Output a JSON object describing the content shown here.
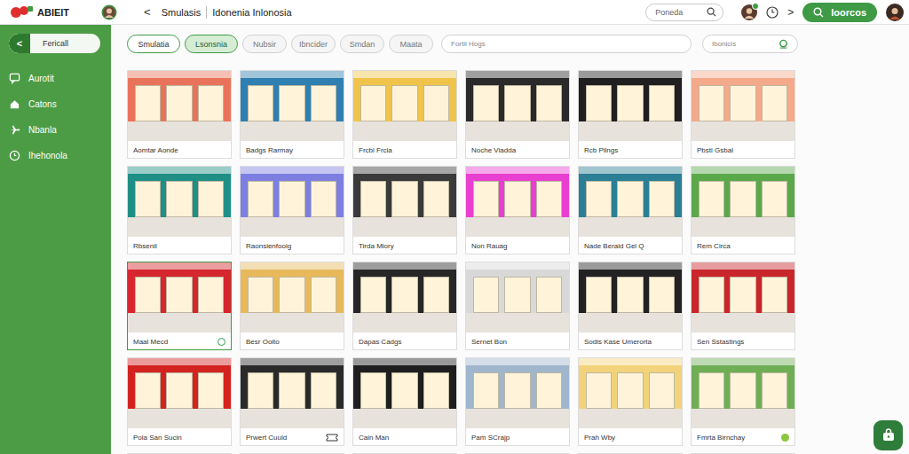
{
  "header": {
    "logo": "ABIEIT",
    "back": "<",
    "breadcrumb": [
      "Smulasis",
      "Idonenia Inlonosia"
    ],
    "search": {
      "placeholder": "Poneda"
    },
    "forward": ">",
    "primary_button": "Ioorcos"
  },
  "sidebar": {
    "back_button": {
      "icon": "<",
      "label": "Fericall"
    },
    "items": [
      {
        "label": "Aurotit",
        "selected": false
      },
      {
        "label": "Catons",
        "selected": false
      },
      {
        "label": "Nbanla",
        "selected": false
      },
      {
        "label": "Ihehonola",
        "selected": false
      }
    ]
  },
  "filters": {
    "chips": [
      {
        "label": "Smulatia",
        "selected": false,
        "outlined": true
      },
      {
        "label": "Lsonsnia",
        "selected": true,
        "outlined": true
      },
      {
        "label": "Nubsir",
        "selected": false,
        "outlined": false
      },
      {
        "label": "Ibncider",
        "selected": false,
        "outlined": false
      },
      {
        "label": "Smdan",
        "selected": false,
        "outlined": false
      },
      {
        "label": "Maata",
        "selected": false,
        "outlined": false
      }
    ],
    "search": {
      "placeholder": "Fortil Hogs"
    },
    "secondary_search": {
      "placeholder": "Ibonicis"
    }
  },
  "cards": [
    {
      "label": "Aomtar Aonde",
      "color": "#e9735a",
      "selected": false
    },
    {
      "label": "Badgs Rarmay",
      "color": "#2f7fb0",
      "selected": false
    },
    {
      "label": "Frcbi Frcia",
      "color": "#f0c44a",
      "selected": false
    },
    {
      "label": "Noche Viadda",
      "color": "#2a2a2a",
      "selected": false
    },
    {
      "label": "Rcb Pilngs",
      "color": "#1f1f1f",
      "selected": false
    },
    {
      "label": "Pbsti Gsbal",
      "color": "#f3a98a",
      "selected": false
    },
    {
      "label": "Rbsenil",
      "color": "#1f8f86",
      "selected": false
    },
    {
      "label": "Raonsienfooig",
      "color": "#7d7fe0",
      "selected": false
    },
    {
      "label": "Tirda Miory",
      "color": "#3a3a3a",
      "selected": false
    },
    {
      "label": "Non Rauag",
      "color": "#e93fd0",
      "selected": false
    },
    {
      "label": "Nade Berald Gel Q",
      "color": "#2a7f95",
      "selected": false
    },
    {
      "label": "Rem Circa",
      "color": "#5aa84a",
      "selected": false
    },
    {
      "label": "Maal Mecd",
      "color": "#d6262e",
      "selected": true,
      "badge": {
        "kind": "ring",
        "color": "#2e9e4f"
      }
    },
    {
      "label": "Besr Ooito",
      "color": "#e7b95a",
      "selected": false
    },
    {
      "label": "Dapas Cadgs",
      "color": "#262626",
      "selected": false
    },
    {
      "label": "Sernet Bon",
      "color": "#d8d8d8",
      "selected": false
    },
    {
      "label": "Sodis Kase Umerorta",
      "color": "#222222",
      "selected": false
    },
    {
      "label": "Sen Sstastings",
      "color": "#c9262c",
      "selected": false
    },
    {
      "label": "Pola San Sucin",
      "color": "#d3231f",
      "selected": false
    },
    {
      "label": "Prwert Cuuld",
      "color": "#2a2a2a",
      "selected": false,
      "badge": {
        "kind": "ticket",
        "color": "#333333"
      }
    },
    {
      "label": "Cain Man",
      "color": "#1e1e1e",
      "selected": false
    },
    {
      "label": "Pam SCrajp",
      "color": "#9fb6cc",
      "selected": false
    },
    {
      "label": "Prah Wby",
      "color": "#f2d27a",
      "selected": false
    },
    {
      "label": "Fmrta Birnchay",
      "color": "#6fae54",
      "selected": false,
      "badge": {
        "kind": "dot",
        "color": "#8dc63f"
      }
    },
    {
      "color": "#d8dde3",
      "selected": false
    },
    {
      "color": "#d0d3d8",
      "selected": false
    },
    {
      "color": "#efc24a",
      "selected": false
    },
    {
      "color": "#dfe3e8",
      "selected": false
    },
    {
      "color": "#1c3e73",
      "selected": false
    },
    {
      "color": "#e9a25a",
      "selected": false
    }
  ]
}
